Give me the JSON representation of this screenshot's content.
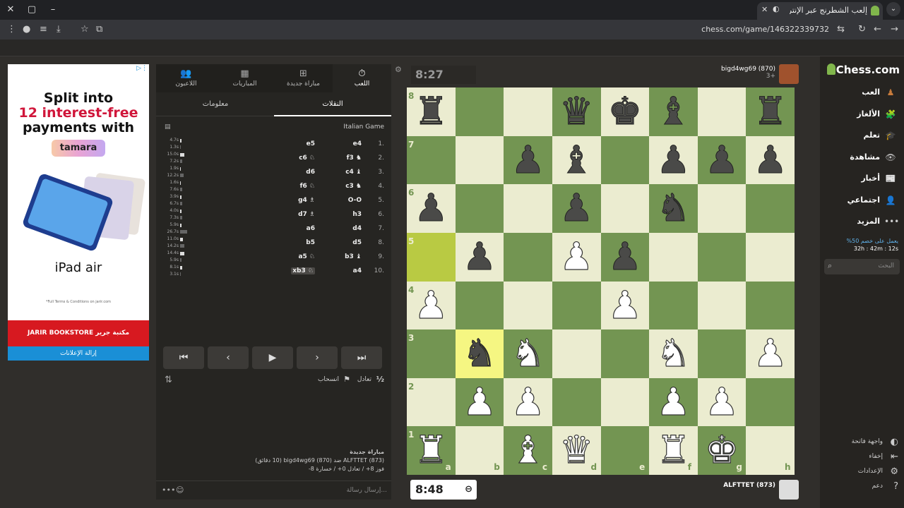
{
  "browser": {
    "tab_title": "إلعب الشطرنج عبر الإنترنت",
    "url": "chess.com/game/146322339732"
  },
  "ad": {
    "line1": "Split into",
    "line2": "12 interest-free",
    "line3": "payments with",
    "tamara": "tamara",
    "ipad": " iPad air",
    "terms": "*Full Terms & Conditions on jarir.com",
    "jarir": "JARIR BOOKSTORE مكتبة جرير",
    "remove": "إزالة الإعلانات"
  },
  "panel": {
    "tabs": [
      "اللعب",
      "مباراة جديدة",
      "المباريات",
      "اللاعبون"
    ],
    "subtabs": [
      "النقلات",
      "معلومات"
    ],
    "opening": "Italian Game",
    "moves": [
      {
        "n": "1.",
        "w": "e4",
        "b": "e5",
        "t1": "4.7s",
        "t2": "1.3s",
        "p1": 2,
        "p2": 1
      },
      {
        "n": "2.",
        "w": "f3 ♞",
        "b": "c6 ♘",
        "t1": "15.0s",
        "t2": "7.2s",
        "p1": 6,
        "p2": 3
      },
      {
        "n": "3.",
        "w": "c4 ♝",
        "b": "d6",
        "t1": "1.9s",
        "t2": "12.2s",
        "p1": 1,
        "p2": 5
      },
      {
        "n": "4.",
        "w": "c3 ♞",
        "b": "f6 ♘",
        "t1": "1.6s",
        "t2": "7.6s",
        "p1": 1,
        "p2": 3
      },
      {
        "n": "5.",
        "w": "O-O",
        "b": "g4 ♗",
        "t1": "3.9s",
        "t2": "6.7s",
        "p1": 2,
        "p2": 3
      },
      {
        "n": "6.",
        "w": "h3",
        "b": "d7 ♗",
        "t1": "4.0s",
        "t2": "7.3s",
        "p1": 2,
        "p2": 3
      },
      {
        "n": "7.",
        "w": "d4",
        "b": "a6",
        "t1": "5.9s",
        "t2": "26.7s",
        "p1": 2,
        "p2": 10
      },
      {
        "n": "8.",
        "w": "d5",
        "b": "b5",
        "t1": "11.0s",
        "t2": "14.2s",
        "p1": 4,
        "p2": 6
      },
      {
        "n": "9.",
        "w": "b3 ♝",
        "b": "a5 ♘",
        "t1": "14.4s",
        "t2": "5.9s",
        "p1": 6,
        "p2": 2
      },
      {
        "n": "10.",
        "w": "a4",
        "b": "xb3 ♘",
        "t1": "8.1s",
        "t2": "3.1s",
        "p1": 3,
        "p2": 1
      }
    ],
    "draw": "تعادل",
    "resign": "انسحاب",
    "half": "½",
    "game_title": "مباراة جديدة",
    "game_desc": "ALFTTET (873) ضد (870) bigd4wg69 (10 دقائق)",
    "game_stats": "فوز 8+ / تعادل 0+ / خسارة 8-",
    "chat_placeholder": "إرسال رسالة..."
  },
  "top": {
    "clock": "8:27",
    "player": "bigd4wg69 (870)",
    "sub": "3+"
  },
  "bottom": {
    "clock": "8:48",
    "player": "ALFTTET (873)"
  },
  "board": {
    "files": [
      "a",
      "b",
      "c",
      "d",
      "e",
      "f",
      "g",
      "h"
    ],
    "ranks": [
      "8",
      "7",
      "6",
      "5",
      "4",
      "3",
      "2",
      "1"
    ],
    "highlight": [
      "a5",
      "b3"
    ],
    "pieces": [
      {
        "sq": "a8",
        "p": "♜",
        "c": "b"
      },
      {
        "sq": "d8",
        "p": "♛",
        "c": "b"
      },
      {
        "sq": "e8",
        "p": "♚",
        "c": "b"
      },
      {
        "sq": "f8",
        "p": "♝",
        "c": "b"
      },
      {
        "sq": "h8",
        "p": "♜",
        "c": "b"
      },
      {
        "sq": "c7",
        "p": "♟",
        "c": "b"
      },
      {
        "sq": "d7",
        "p": "♝",
        "c": "b"
      },
      {
        "sq": "f7",
        "p": "♟",
        "c": "b"
      },
      {
        "sq": "g7",
        "p": "♟",
        "c": "b"
      },
      {
        "sq": "h7",
        "p": "♟",
        "c": "b"
      },
      {
        "sq": "a6",
        "p": "♟",
        "c": "b"
      },
      {
        "sq": "d6",
        "p": "♟",
        "c": "b"
      },
      {
        "sq": "f6",
        "p": "♞",
        "c": "b"
      },
      {
        "sq": "b5",
        "p": "♟",
        "c": "b"
      },
      {
        "sq": "d5",
        "p": "♟",
        "c": "w"
      },
      {
        "sq": "e5",
        "p": "♟",
        "c": "b"
      },
      {
        "sq": "a4",
        "p": "♟",
        "c": "w"
      },
      {
        "sq": "e4",
        "p": "♟",
        "c": "w"
      },
      {
        "sq": "b3",
        "p": "♞",
        "c": "b"
      },
      {
        "sq": "c3",
        "p": "♞",
        "c": "w"
      },
      {
        "sq": "f3",
        "p": "♞",
        "c": "w"
      },
      {
        "sq": "h3",
        "p": "♟",
        "c": "w"
      },
      {
        "sq": "b2",
        "p": "♟",
        "c": "w"
      },
      {
        "sq": "c2",
        "p": "♟",
        "c": "w"
      },
      {
        "sq": "f2",
        "p": "♟",
        "c": "w"
      },
      {
        "sq": "g2",
        "p": "♟",
        "c": "w"
      },
      {
        "sq": "a1",
        "p": "♜",
        "c": "w"
      },
      {
        "sq": "c1",
        "p": "♝",
        "c": "w"
      },
      {
        "sq": "d1",
        "p": "♛",
        "c": "w"
      },
      {
        "sq": "f1",
        "p": "♜",
        "c": "w"
      },
      {
        "sq": "g1",
        "p": "♚",
        "c": "w"
      }
    ]
  },
  "nav": {
    "logo": "Chess.com",
    "items": [
      "العب",
      "الألغاز",
      "تعلم",
      "مشاهدة",
      "أخبار",
      "اجتماعي",
      "المزيد"
    ],
    "icon_colors": [
      "#c77b3b",
      "#e2673a",
      "#4aa3d8",
      "#bbbbbb",
      "#dddddd",
      "#e8c09a",
      "#cccccc"
    ],
    "promo1": "%50 يعمل على خصم",
    "promo2": "32h : 42m : 12s",
    "search": "البحث",
    "bottom": [
      "واجهة فاتحة",
      "إخفاء",
      "الإعدادات",
      "دعم"
    ]
  }
}
